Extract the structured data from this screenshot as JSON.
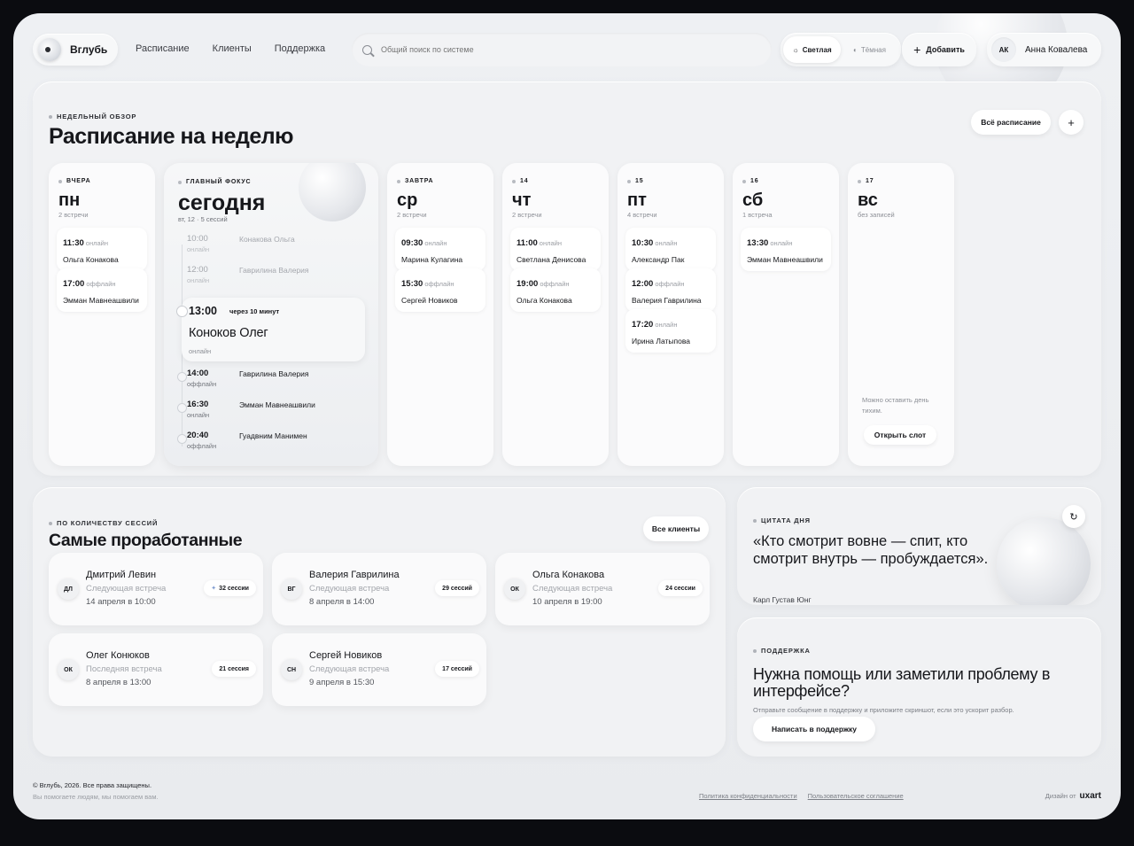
{
  "header": {
    "logo_text": "Вглубь",
    "nav": [
      "Расписание",
      "Клиенты",
      "Поддержка"
    ],
    "search_placeholder": "Общий поиск по системе",
    "theme_light": "Светлая",
    "theme_dark": "Тёмная",
    "add_label": "Добавить",
    "user_initials": "АК",
    "user_name": "Анна Ковалева"
  },
  "week": {
    "eyebrow": "Недельный обзор",
    "title": "Расписание на неделю",
    "all_schedule": "Всё расписание",
    "plus": "+",
    "days": [
      {
        "tag": "Вчера",
        "name": "пн",
        "sub": "2 встречи",
        "appts": [
          {
            "time": "11:30",
            "mode": "онлайн",
            "name": "Ольга Конакова"
          },
          {
            "time": "17:00",
            "mode": "оффлайн",
            "name": "Эмман Мавнеашвили"
          }
        ]
      },
      {
        "tag": "Завтра",
        "name": "ср",
        "sub": "2 встречи",
        "appts": [
          {
            "time": "09:30",
            "mode": "онлайн",
            "name": "Марина Кулагина"
          },
          {
            "time": "15:30",
            "mode": "оффлайн",
            "name": "Сергей Новиков"
          }
        ]
      },
      {
        "tag": "14",
        "name": "чт",
        "sub": "2 встречи",
        "appts": [
          {
            "time": "11:00",
            "mode": "онлайн",
            "name": "Светлана Денисова"
          },
          {
            "time": "19:00",
            "mode": "оффлайн",
            "name": "Ольга Конакова"
          }
        ]
      },
      {
        "tag": "15",
        "name": "пт",
        "sub": "4 встречи",
        "appts": [
          {
            "time": "10:30",
            "mode": "онлайн",
            "name": "Александр Пак"
          },
          {
            "time": "12:00",
            "mode": "оффлайн",
            "name": "Валерия Гаврилина"
          },
          {
            "time": "17:20",
            "mode": "онлайн",
            "name": "Ирина Латыпова"
          }
        ]
      },
      {
        "tag": "16",
        "name": "сб",
        "sub": "1 встреча",
        "appts": [
          {
            "time": "13:30",
            "mode": "онлайн",
            "name": "Эмман Мавнеашвили"
          }
        ]
      },
      {
        "tag": "17",
        "name": "вс",
        "sub": "без записей",
        "empty_note": "Можно оставить день тихим.",
        "open_slot": "Открыть слот",
        "appts": []
      }
    ],
    "today": {
      "tag": "Главный фокус",
      "title": "сегодня",
      "sub": "вт, 12 · 5 сессий",
      "past": [
        {
          "time": "10:00",
          "mode": "онлайн",
          "name": "Конакова Ольга"
        },
        {
          "time": "12:00",
          "mode": "онлайн",
          "name": "Гаврилина Валерия"
        }
      ],
      "focus": {
        "time": "13:00",
        "in": "через 10 минут",
        "name": "Коноков Олег",
        "mode": "онлайн"
      },
      "upcoming": [
        {
          "time": "14:00",
          "mode": "оффлайн",
          "name": "Гаврилина Валерия"
        },
        {
          "time": "16:30",
          "mode": "онлайн",
          "name": "Эмман Мавнеашвили"
        },
        {
          "time": "20:40",
          "mode": "оффлайн",
          "name": "Гуадвним Манимен"
        }
      ]
    }
  },
  "clients": {
    "eyebrow": "По количеству сессий",
    "title": "Самые проработанные",
    "all_clients": "Все клиенты",
    "items": [
      {
        "initials": "ДЛ",
        "name": "Дмитрий Левин",
        "label": "Следующая встреча",
        "date": "14 апреля в 10:00",
        "sessions": "32 сессии",
        "star": "✦"
      },
      {
        "initials": "ВГ",
        "name": "Валерия Гаврилина",
        "label": "Следующая встреча",
        "date": "8 апреля в 14:00",
        "sessions": "29 сессий"
      },
      {
        "initials": "ОК",
        "name": "Ольга Конакова",
        "label": "Следующая встреча",
        "date": "10 апреля в 19:00",
        "sessions": "24 сессии"
      },
      {
        "initials": "ОК",
        "name": "Олег Конюков",
        "label": "Последняя встреча",
        "date": "8 апреля в 13:00",
        "sessions": "21 сессия"
      },
      {
        "initials": "СН",
        "name": "Сергей Новиков",
        "label": "Следующая встреча",
        "date": "9 апреля в 15:30",
        "sessions": "17 сессий"
      }
    ]
  },
  "quote": {
    "eyebrow": "Цитата дня",
    "text": "«Кто смотрит вовне — спит, кто смотрит внутрь — пробуждается».",
    "author": "Карл Густав Юнг"
  },
  "support": {
    "eyebrow": "Поддержка",
    "title": "Нужна помощь или заметили проблему в интерфейсе?",
    "sub": "Отправьте сообщение в поддержку и приложите скриншот, если это ускорит разбор.",
    "button": "Написать в поддержку"
  },
  "footer": {
    "copyright": "© Вглубь, 2026. Все права защищены.",
    "tagline": "Вы помогаете людям, мы помогаем вам.",
    "privacy": "Политика конфиденциальности",
    "terms": "Пользовательское соглашение",
    "design_by": "Дизайн от",
    "brand": "uxart"
  }
}
